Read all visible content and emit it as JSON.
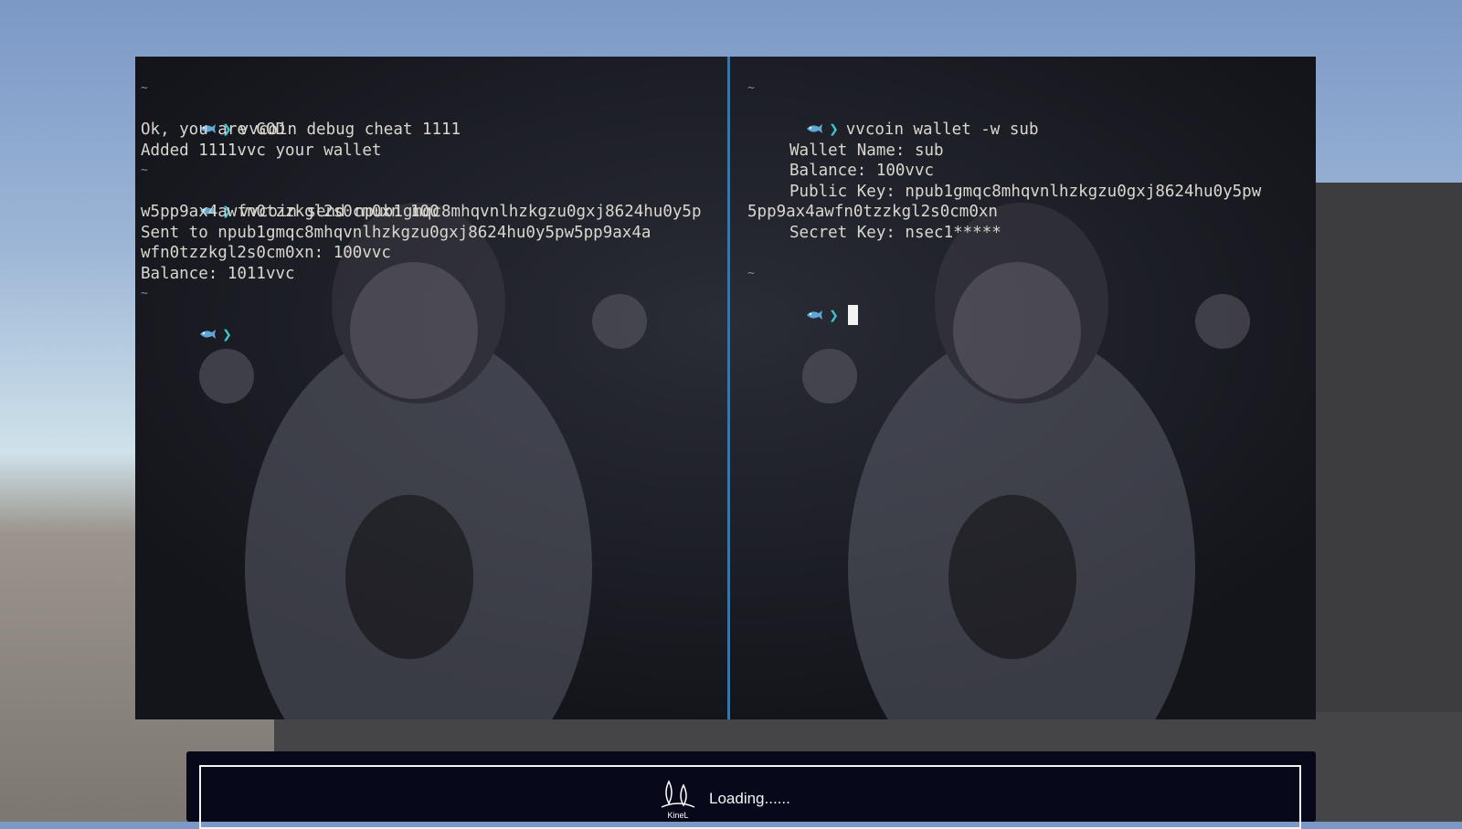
{
  "left_pane": {
    "tilde": "~",
    "cmd1": "vvcoin debug cheat 1111",
    "out1": "Ok, you are GOD",
    "out2": "Added 1111vvc your wallet",
    "cmd2_a": "vvcoin send npub1gmqc8mhqvnlhzkgzu0gxj8624hu0y5p",
    "cmd2_b": "w5pp9ax4awfn0tzzkgl2s0cm0xn 100",
    "out3_a": "Sent to npub1gmqc8mhqvnlhzkgzu0gxj8624hu0y5pw5pp9ax4a",
    "out3_b": "wfn0tzzkgl2s0cm0xn: 100vvc",
    "out4": "Balance: 1011vvc"
  },
  "right_pane": {
    "tilde": "~",
    "cmd1": "vvcoin wallet -w sub",
    "wallet_name": "Wallet Name: sub",
    "balance": "Balance: 100vvc",
    "pubkey_a": "Public Key: npub1gmqc8mhqvnlhzkgzu0gxj8624hu0y5pw",
    "pubkey_b": "5pp9ax4awfn0tzzkgl2s0cm0xn",
    "secret": "Secret Key: nsec1*****"
  },
  "prompt": {
    "icon": "fish-icon",
    "arrow": "❯"
  },
  "loading": {
    "logo_text": "KineL",
    "text": "Loading......"
  },
  "colors": {
    "divider": "#2c79b8",
    "prompt_arrow": "#39c8d6",
    "terminal_bg": "#16171d",
    "loading_bg": "#07081a"
  }
}
